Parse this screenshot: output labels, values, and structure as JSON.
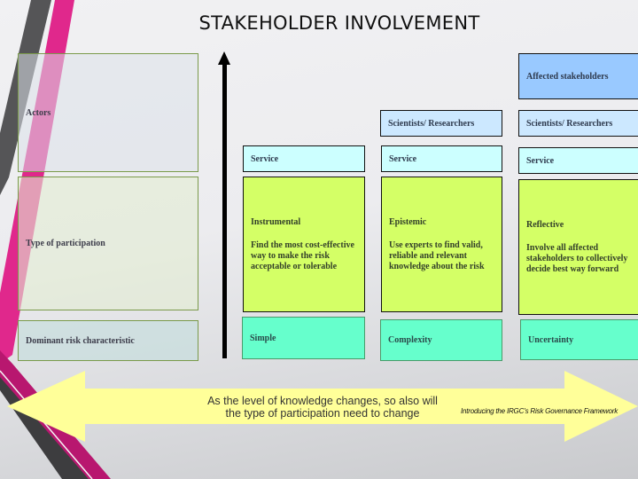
{
  "slide": {
    "title": "STAKEHOLDER INVOLVEMENT",
    "colors": {
      "affected": "#99c9ff",
      "scientists": "#cce8ff",
      "service": "#ccffff",
      "participation": "#d4ff66",
      "risk": "#66ffcc",
      "arrow": "#ffff99",
      "accent_pink": "#e0288c",
      "accent_dark": "#444444"
    }
  },
  "row_labels": {
    "actors": "Actors",
    "type": "Type of participation",
    "risk": "Dominant risk characteristic"
  },
  "columns": [
    {
      "actors": [
        "Service"
      ],
      "participation_title": "Instrumental",
      "participation_desc": "Find the most cost-effective way to make the risk acceptable or tolerable",
      "risk": "Simple"
    },
    {
      "actors": [
        "Scientists/ Researchers",
        "Service"
      ],
      "participation_title": "Epistemic",
      "participation_desc": "Use experts to find valid, reliable and relevant knowledge about the risk",
      "risk": "Complexity"
    },
    {
      "actors": [
        "Affected stakeholders",
        "Scientists/ Researchers",
        "Service"
      ],
      "participation_title": "Reflective",
      "participation_desc": "Involve all affected stakeholders to collectively decide best way forward",
      "risk": "Uncertainty"
    }
  ],
  "arrow": {
    "text": "As the level of knowledge changes, so also will the type of participation need to change"
  },
  "credit": "Introducing the IRGC’s Risk Governance Framework"
}
